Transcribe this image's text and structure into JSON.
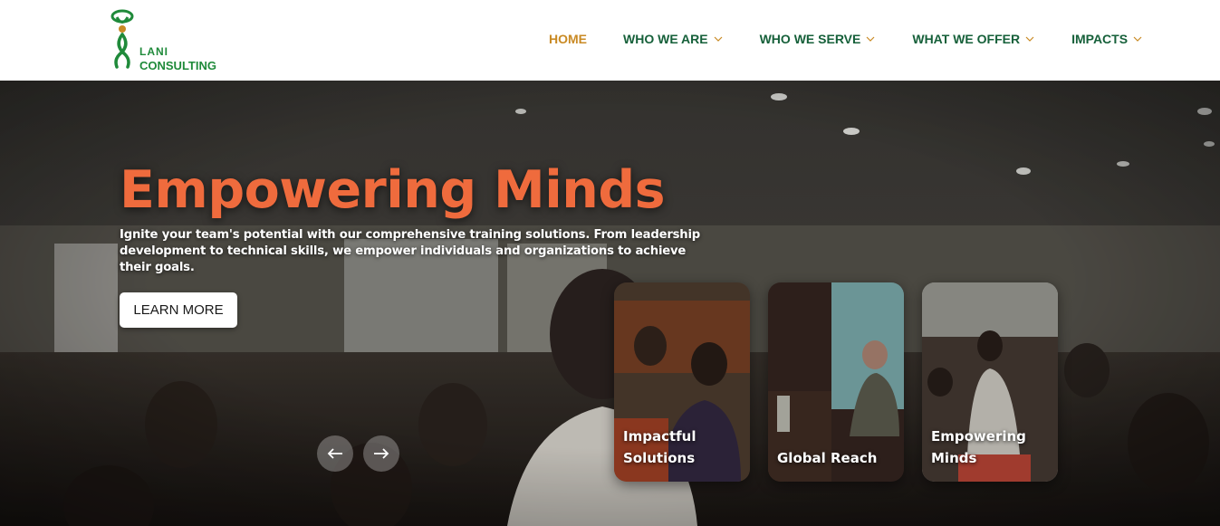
{
  "brand": {
    "line1": "LANI",
    "line2": "CONSULTING",
    "color": "#1f8a3a"
  },
  "nav": {
    "items": [
      {
        "label": "HOME",
        "active": true,
        "has_dropdown": false
      },
      {
        "label": "WHO WE ARE",
        "active": false,
        "has_dropdown": true
      },
      {
        "label": "WHO WE SERVE",
        "active": false,
        "has_dropdown": true
      },
      {
        "label": "WHAT WE OFFER",
        "active": false,
        "has_dropdown": true
      },
      {
        "label": "IMPACTS",
        "active": false,
        "has_dropdown": true
      }
    ],
    "active_color": "#c98a24",
    "color": "#16603a"
  },
  "hero": {
    "title": "Empowering Minds",
    "title_color": "#ef6b3d",
    "text": "Ignite your team's potential with our comprehensive training solutions. From leadership development to technical skills, we empower individuals and organizations to achieve their goals.",
    "cta_label": "LEARN MORE",
    "prev_icon": "arrow-left-icon",
    "next_icon": "arrow-right-icon"
  },
  "cards": [
    {
      "label": "Impactful Solutions"
    },
    {
      "label": "Global Reach"
    },
    {
      "label": "Empowering Minds"
    }
  ]
}
